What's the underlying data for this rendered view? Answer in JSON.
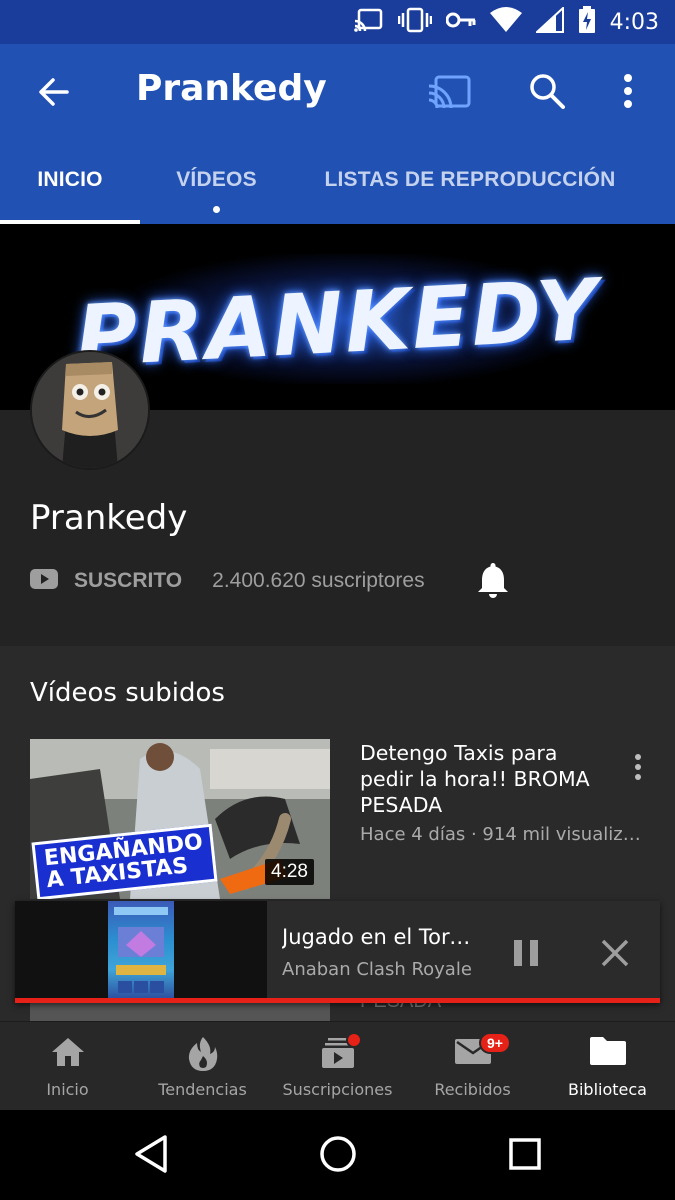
{
  "status_bar": {
    "time": "4:03"
  },
  "app_bar": {
    "title": "Prankedy"
  },
  "tabs": [
    {
      "label": "INICIO",
      "active": true
    },
    {
      "label": "VÍDEOS",
      "active": false
    },
    {
      "label": "LISTAS DE REPRODUCCIÓN",
      "active": false
    }
  ],
  "banner": {
    "text": "PRANKEDY"
  },
  "channel": {
    "name": "Prankedy",
    "subscribe_label": "SUSCRITO",
    "subscribers": "2.400.620 suscriptores"
  },
  "uploads": {
    "title": "Vídeos subidos",
    "videos": [
      {
        "title": "Detengo Taxis para pedir la hora!! BROMA PESADA",
        "meta": "Hace 4 días · 914 mil visualizaciones",
        "duration": "4:28",
        "thumb_caption_line1": "ENGAÑANDO",
        "thumb_caption_line2": "A TAXISTAS"
      }
    ],
    "behind_text": "PESADA"
  },
  "miniplayer": {
    "title": "Jugado en el Torneo",
    "channel": "Anaban Clash Royale",
    "progress": 1.0
  },
  "bottom_nav": [
    {
      "label": "Inicio",
      "icon": "home-icon",
      "active": false
    },
    {
      "label": "Tendencias",
      "icon": "trending-icon",
      "active": false
    },
    {
      "label": "Suscripciones",
      "icon": "subscriptions-icon",
      "active": false
    },
    {
      "label": "Recibidos",
      "icon": "inbox-icon",
      "active": false,
      "badge": "9+"
    },
    {
      "label": "Biblioteca",
      "icon": "library-icon",
      "active": true
    }
  ],
  "colors": {
    "status_bar": "#1a3d9c",
    "app_bar": "#2151b3",
    "accent_red": "#e62117",
    "background": "#212121"
  }
}
